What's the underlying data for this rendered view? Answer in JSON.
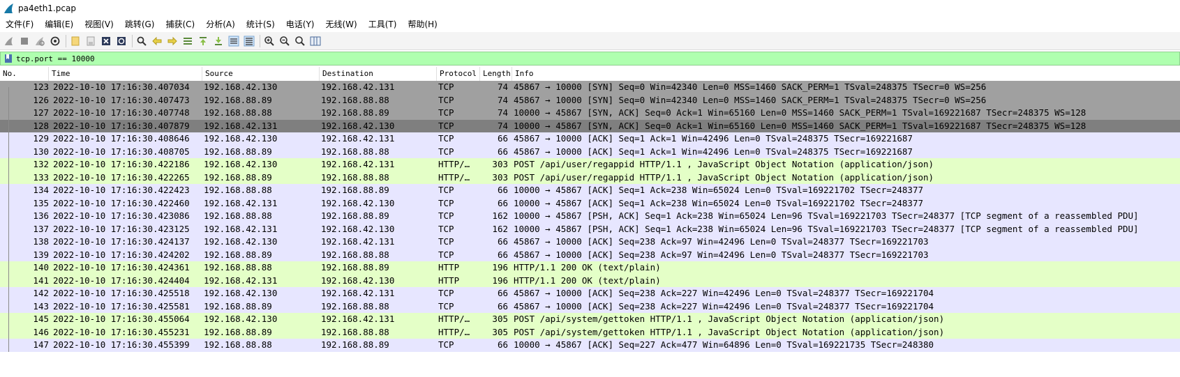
{
  "window": {
    "title": "pa4eth1.pcap"
  },
  "menu": [
    "文件(F)",
    "编辑(E)",
    "视图(V)",
    "跳转(G)",
    "捕获(C)",
    "分析(A)",
    "统计(S)",
    "电话(Y)",
    "无线(W)",
    "工具(T)",
    "帮助(H)"
  ],
  "toolbar": {
    "icons": [
      "start-capture-icon",
      "stop-capture-icon",
      "restart-capture-icon",
      "capture-options-icon",
      "open-file-icon",
      "save-file-icon",
      "close-file-icon",
      "reload-file-icon",
      "find-packet-icon",
      "go-back-icon",
      "go-forward-icon",
      "go-to-packet-icon",
      "go-first-icon",
      "go-last-icon",
      "autoscroll-icon",
      "colorize-icon",
      "zoom-in-icon",
      "zoom-out-icon",
      "zoom-normal-icon",
      "resize-columns-icon"
    ]
  },
  "filter": {
    "text": "tcp.port == 10000"
  },
  "columns": [
    "No.",
    "Time",
    "Source",
    "Destination",
    "Protocol",
    "Length",
    "Info"
  ],
  "colors": {
    "tcp": "#e7e6ff",
    "http": "#e4ffc7",
    "handshake": "#a0a0a0",
    "selected": "#7f7f7f",
    "filter_bg": "#afffaf"
  },
  "packets": [
    {
      "no": "123",
      "time": "2022-10-10 17:16:30.407034",
      "src": "192.168.42.130",
      "dst": "192.168.42.131",
      "proto": "TCP",
      "len": "74",
      "info": "45867 → 10000 [SYN] Seq=0 Win=42340 Len=0 MSS=1460 SACK_PERM=1 TSval=248375 TSecr=0 WS=256",
      "kind": "handshake"
    },
    {
      "no": "126",
      "time": "2022-10-10 17:16:30.407473",
      "src": "192.168.88.89",
      "dst": "192.168.88.88",
      "proto": "TCP",
      "len": "74",
      "info": "45867 → 10000 [SYN] Seq=0 Win=42340 Len=0 MSS=1460 SACK_PERM=1 TSval=248375 TSecr=0 WS=256",
      "kind": "handshake"
    },
    {
      "no": "127",
      "time": "2022-10-10 17:16:30.407748",
      "src": "192.168.88.88",
      "dst": "192.168.88.89",
      "proto": "TCP",
      "len": "74",
      "info": "10000 → 45867 [SYN, ACK] Seq=0 Ack=1 Win=65160 Len=0 MSS=1460 SACK_PERM=1 TSval=169221687 TSecr=248375 WS=128",
      "kind": "handshake"
    },
    {
      "no": "128",
      "time": "2022-10-10 17:16:30.407879",
      "src": "192.168.42.131",
      "dst": "192.168.42.130",
      "proto": "TCP",
      "len": "74",
      "info": "10000 → 45867 [SYN, ACK] Seq=0 Ack=1 Win=65160 Len=0 MSS=1460 SACK_PERM=1 TSval=169221687 TSecr=248375 WS=128",
      "kind": "selected"
    },
    {
      "no": "129",
      "time": "2022-10-10 17:16:30.408646",
      "src": "192.168.42.130",
      "dst": "192.168.42.131",
      "proto": "TCP",
      "len": "66",
      "info": "45867 → 10000 [ACK] Seq=1 Ack=1 Win=42496 Len=0 TSval=248375 TSecr=169221687",
      "kind": "tcp"
    },
    {
      "no": "130",
      "time": "2022-10-10 17:16:30.408705",
      "src": "192.168.88.89",
      "dst": "192.168.88.88",
      "proto": "TCP",
      "len": "66",
      "info": "45867 → 10000 [ACK] Seq=1 Ack=1 Win=42496 Len=0 TSval=248375 TSecr=169221687",
      "kind": "tcp"
    },
    {
      "no": "132",
      "time": "2022-10-10 17:16:30.422186",
      "src": "192.168.42.130",
      "dst": "192.168.42.131",
      "proto": "HTTP/…",
      "len": "303",
      "info": "POST /api/user/regappid HTTP/1.1 , JavaScript Object Notation (application/json)",
      "kind": "http"
    },
    {
      "no": "133",
      "time": "2022-10-10 17:16:30.422265",
      "src": "192.168.88.89",
      "dst": "192.168.88.88",
      "proto": "HTTP/…",
      "len": "303",
      "info": "POST /api/user/regappid HTTP/1.1 , JavaScript Object Notation (application/json)",
      "kind": "http"
    },
    {
      "no": "134",
      "time": "2022-10-10 17:16:30.422423",
      "src": "192.168.88.88",
      "dst": "192.168.88.89",
      "proto": "TCP",
      "len": "66",
      "info": "10000 → 45867 [ACK] Seq=1 Ack=238 Win=65024 Len=0 TSval=169221702 TSecr=248377",
      "kind": "tcp"
    },
    {
      "no": "135",
      "time": "2022-10-10 17:16:30.422460",
      "src": "192.168.42.131",
      "dst": "192.168.42.130",
      "proto": "TCP",
      "len": "66",
      "info": "10000 → 45867 [ACK] Seq=1 Ack=238 Win=65024 Len=0 TSval=169221702 TSecr=248377",
      "kind": "tcp"
    },
    {
      "no": "136",
      "time": "2022-10-10 17:16:30.423086",
      "src": "192.168.88.88",
      "dst": "192.168.88.89",
      "proto": "TCP",
      "len": "162",
      "info": "10000 → 45867 [PSH, ACK] Seq=1 Ack=238 Win=65024 Len=96 TSval=169221703 TSecr=248377 [TCP segment of a reassembled PDU]",
      "kind": "tcp"
    },
    {
      "no": "137",
      "time": "2022-10-10 17:16:30.423125",
      "src": "192.168.42.131",
      "dst": "192.168.42.130",
      "proto": "TCP",
      "len": "162",
      "info": "10000 → 45867 [PSH, ACK] Seq=1 Ack=238 Win=65024 Len=96 TSval=169221703 TSecr=248377 [TCP segment of a reassembled PDU]",
      "kind": "tcp"
    },
    {
      "no": "138",
      "time": "2022-10-10 17:16:30.424137",
      "src": "192.168.42.130",
      "dst": "192.168.42.131",
      "proto": "TCP",
      "len": "66",
      "info": "45867 → 10000 [ACK] Seq=238 Ack=97 Win=42496 Len=0 TSval=248377 TSecr=169221703",
      "kind": "tcp"
    },
    {
      "no": "139",
      "time": "2022-10-10 17:16:30.424202",
      "src": "192.168.88.89",
      "dst": "192.168.88.88",
      "proto": "TCP",
      "len": "66",
      "info": "45867 → 10000 [ACK] Seq=238 Ack=97 Win=42496 Len=0 TSval=248377 TSecr=169221703",
      "kind": "tcp"
    },
    {
      "no": "140",
      "time": "2022-10-10 17:16:30.424361",
      "src": "192.168.88.88",
      "dst": "192.168.88.89",
      "proto": "HTTP",
      "len": "196",
      "info": "HTTP/1.1 200 OK  (text/plain)",
      "kind": "http"
    },
    {
      "no": "141",
      "time": "2022-10-10 17:16:30.424404",
      "src": "192.168.42.131",
      "dst": "192.168.42.130",
      "proto": "HTTP",
      "len": "196",
      "info": "HTTP/1.1 200 OK  (text/plain)",
      "kind": "http"
    },
    {
      "no": "142",
      "time": "2022-10-10 17:16:30.425518",
      "src": "192.168.42.130",
      "dst": "192.168.42.131",
      "proto": "TCP",
      "len": "66",
      "info": "45867 → 10000 [ACK] Seq=238 Ack=227 Win=42496 Len=0 TSval=248377 TSecr=169221704",
      "kind": "tcp"
    },
    {
      "no": "143",
      "time": "2022-10-10 17:16:30.425581",
      "src": "192.168.88.89",
      "dst": "192.168.88.88",
      "proto": "TCP",
      "len": "66",
      "info": "45867 → 10000 [ACK] Seq=238 Ack=227 Win=42496 Len=0 TSval=248377 TSecr=169221704",
      "kind": "tcp"
    },
    {
      "no": "145",
      "time": "2022-10-10 17:16:30.455064",
      "src": "192.168.42.130",
      "dst": "192.168.42.131",
      "proto": "HTTP/…",
      "len": "305",
      "info": "POST /api/system/gettoken HTTP/1.1 , JavaScript Object Notation (application/json)",
      "kind": "http"
    },
    {
      "no": "146",
      "time": "2022-10-10 17:16:30.455231",
      "src": "192.168.88.89",
      "dst": "192.168.88.88",
      "proto": "HTTP/…",
      "len": "305",
      "info": "POST /api/system/gettoken HTTP/1.1 , JavaScript Object Notation (application/json)",
      "kind": "http"
    },
    {
      "no": "147",
      "time": "2022-10-10 17:16:30.455399",
      "src": "192.168.88.88",
      "dst": "192.168.88.89",
      "proto": "TCP",
      "len": "66",
      "info": "10000 → 45867 [ACK] Seq=227 Ack=477 Win=64896 Len=0 TSval=169221735 TSecr=248380",
      "kind": "tcp"
    }
  ]
}
